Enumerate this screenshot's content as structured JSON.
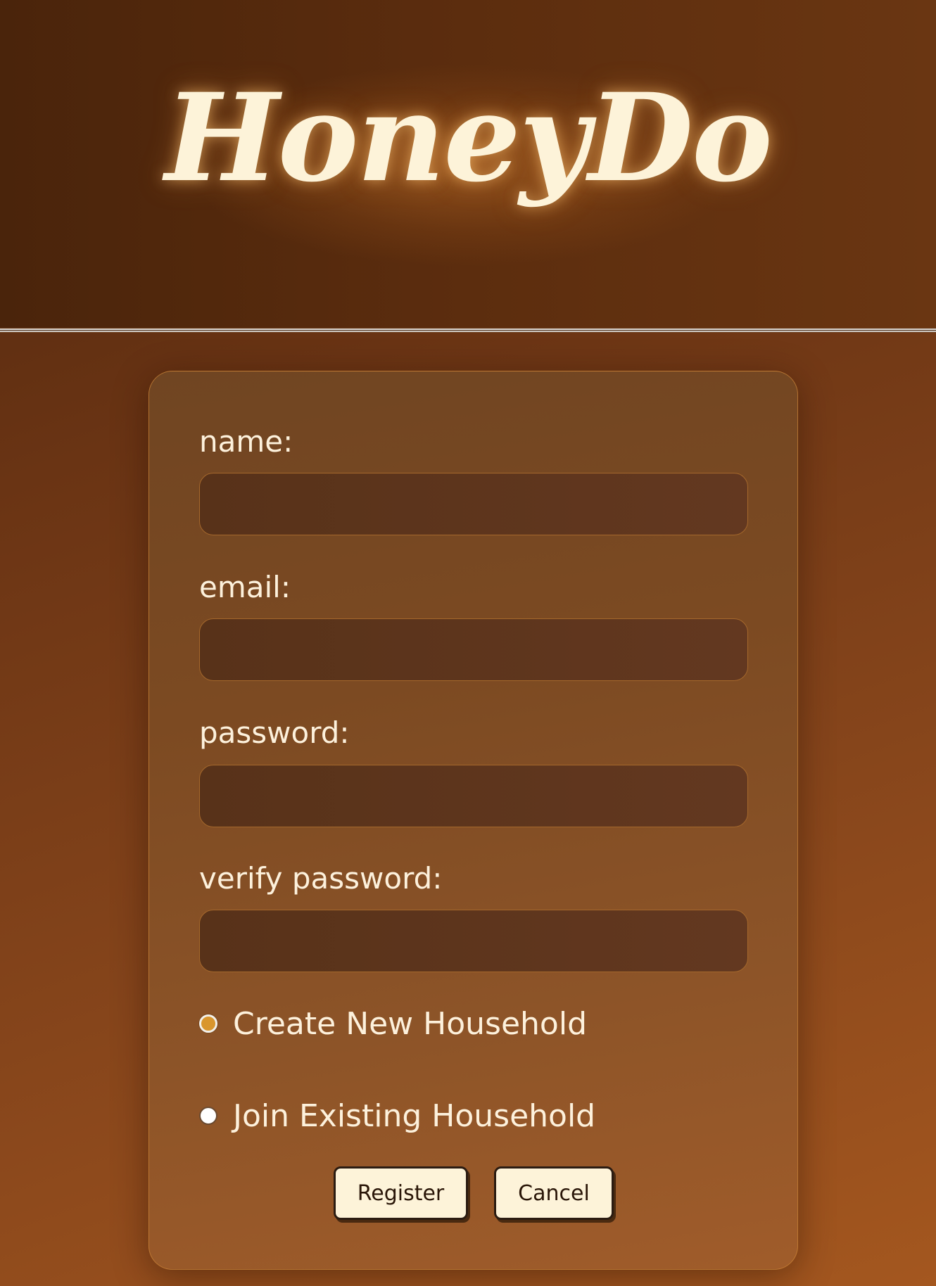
{
  "header": {
    "logo_text": "HoneyDo"
  },
  "form": {
    "name_label": "name:",
    "name_value": "",
    "email_label": "email:",
    "email_value": "",
    "password_label": "password:",
    "password_value": "",
    "verify_password_label": "verify password:",
    "verify_password_value": "",
    "household_options": [
      {
        "label": "Create New Household",
        "selected": true
      },
      {
        "label": "Join Existing Household",
        "selected": false
      }
    ],
    "register_label": "Register",
    "cancel_label": "Cancel"
  },
  "colors": {
    "background_dark": "#4e260c",
    "background_light": "#a4571f",
    "logo_text": "#fdf3d9",
    "input_fill": "#583219",
    "input_border": "#a5682c",
    "radio_selected": "#d9962e",
    "button_fill": "#fdf3d9"
  }
}
